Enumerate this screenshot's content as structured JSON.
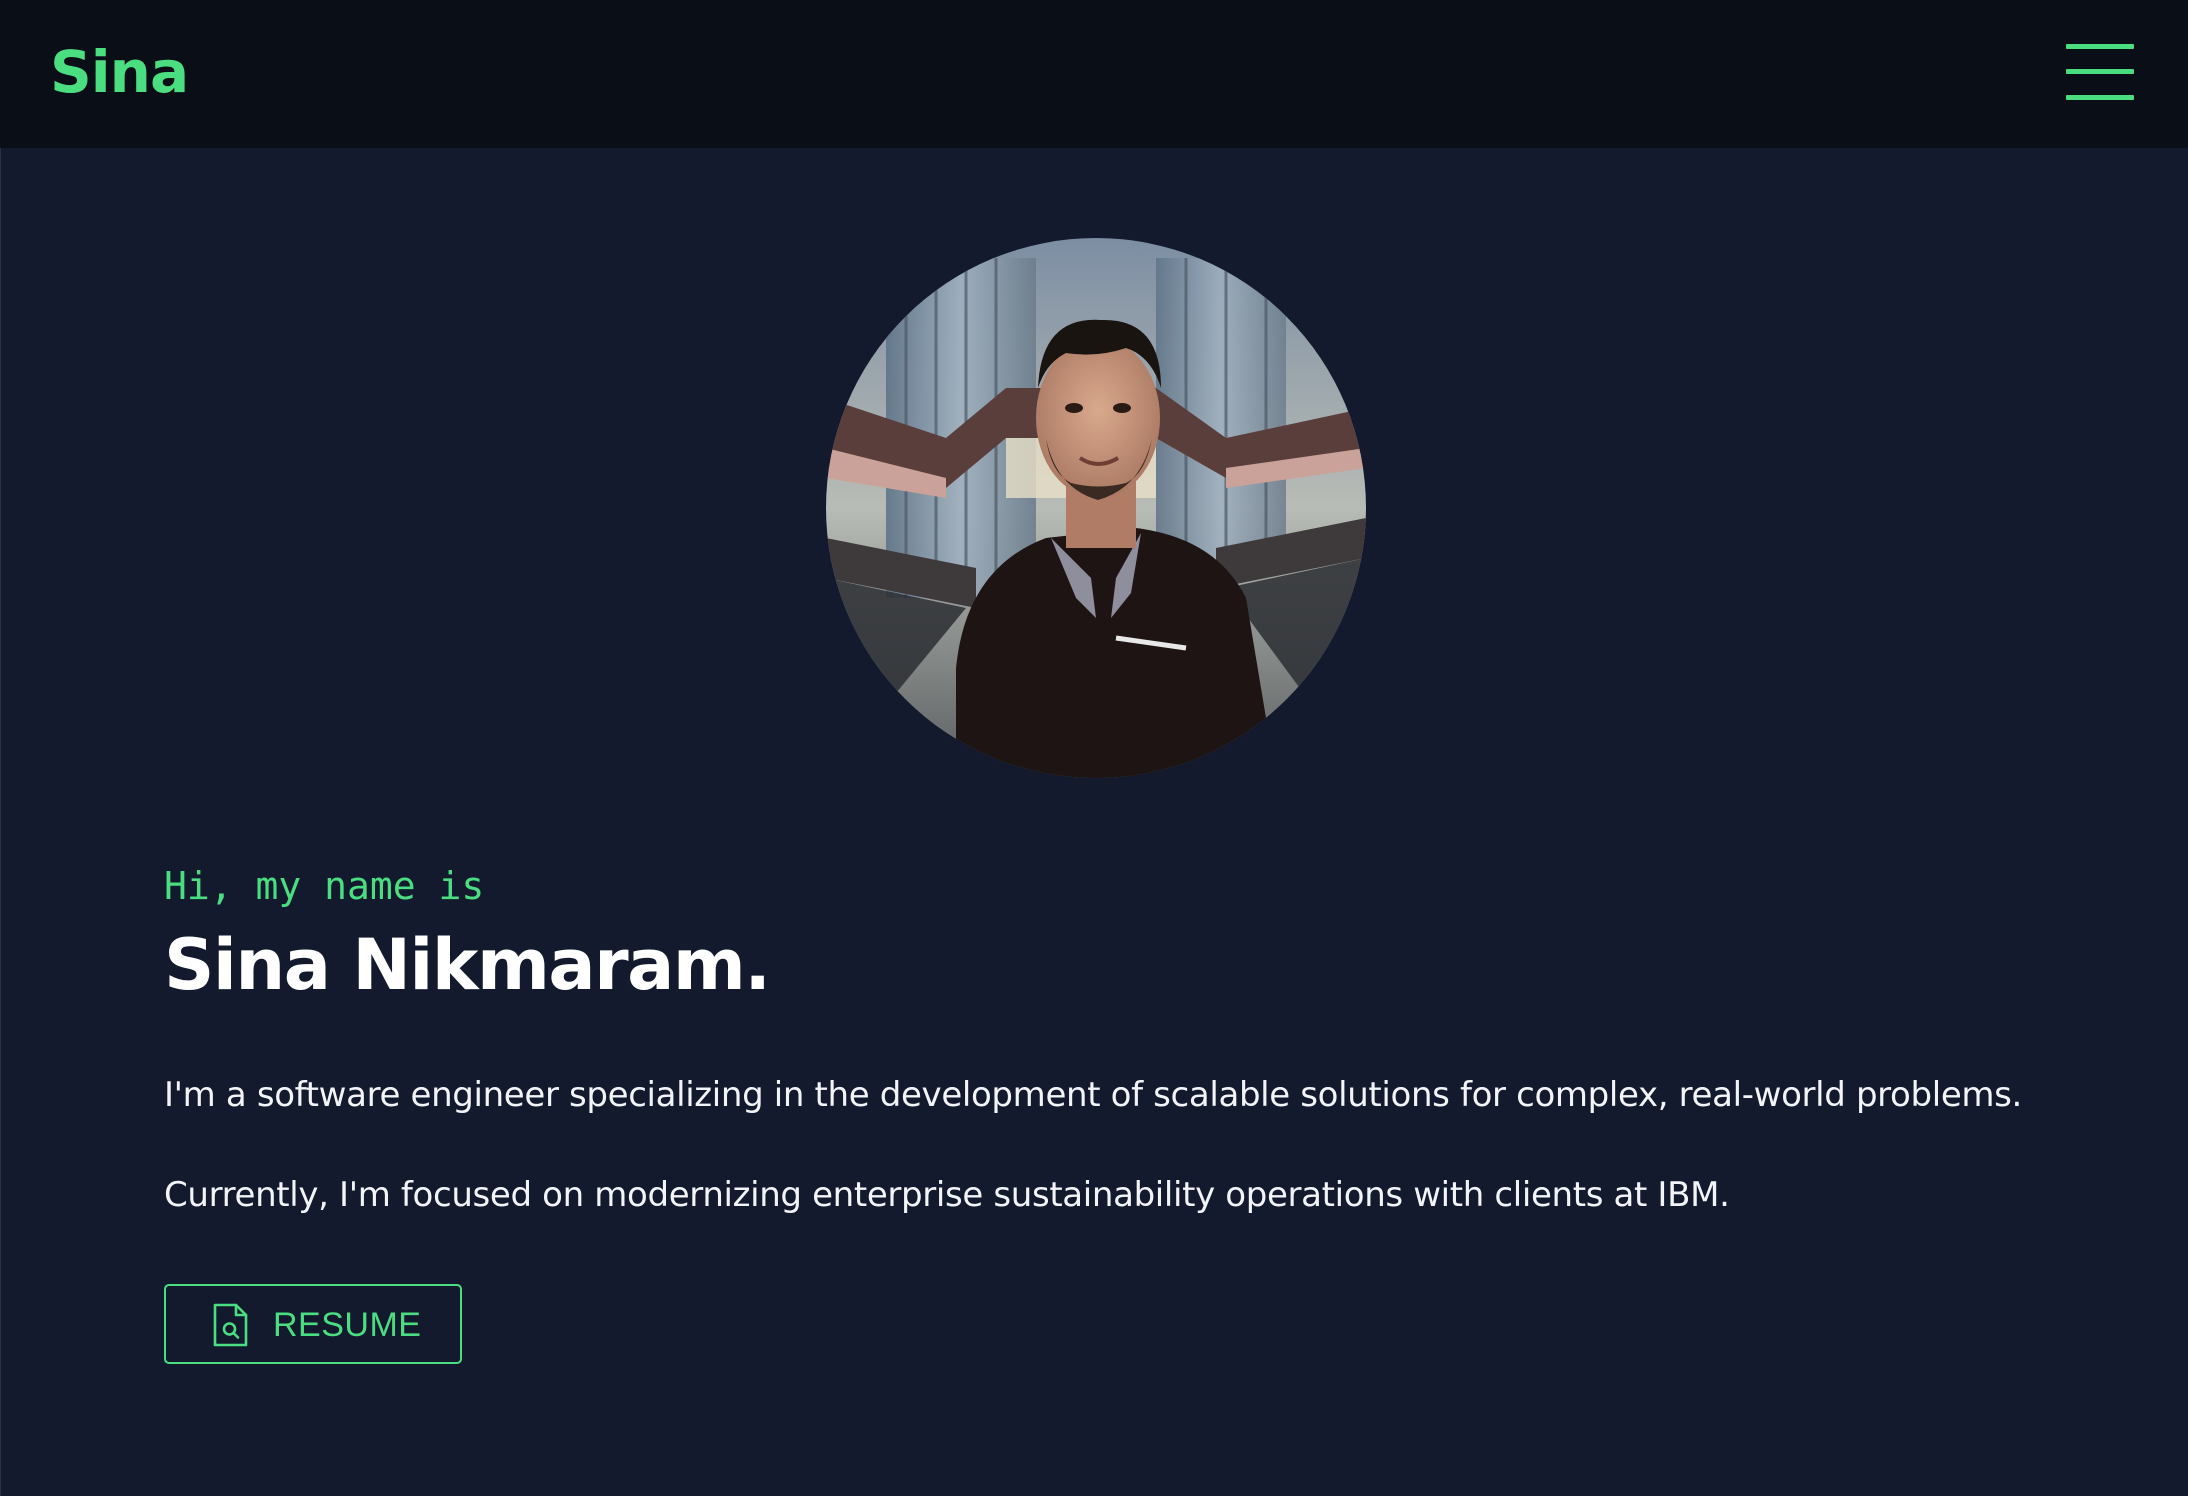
{
  "header": {
    "brand": "Sina",
    "menu_icon": "hamburger-menu-icon"
  },
  "hero": {
    "photo_alt": "Portrait of Sina Nikmaram",
    "greeting": "Hi, my name is",
    "name": "Sina Nikmaram.",
    "intro": "I'm a software engineer specializing in the development of scalable solutions for complex, real-world problems.",
    "current": "Currently, I'm focused on modernizing enterprise sustainability operations with clients at IBM.",
    "resume_button": {
      "label": "RESUME",
      "icon": "document-search-icon"
    }
  },
  "colors": {
    "background": "#131a2e",
    "navbar": "#0a0e17",
    "accent": "#4ade80",
    "text": "#ffffff"
  }
}
